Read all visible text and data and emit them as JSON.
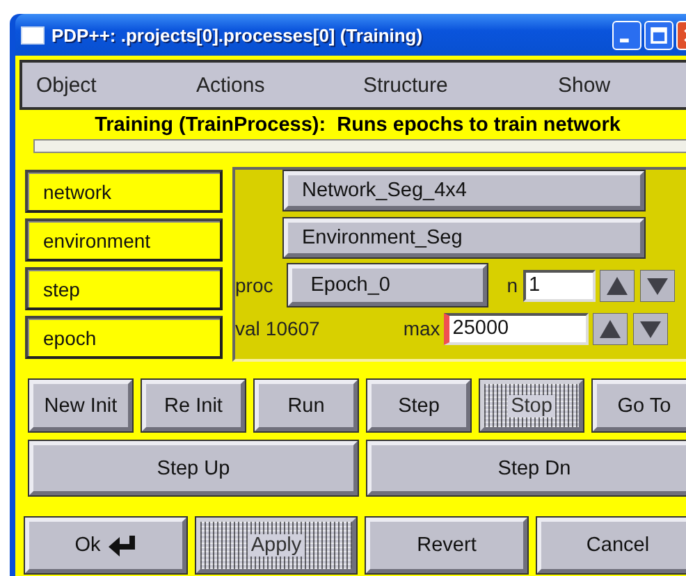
{
  "window": {
    "title": "PDP++:  .projects[0].processes[0] (Training)"
  },
  "menu": [
    "Object",
    "Actions",
    "Structure",
    "Show"
  ],
  "heading": "Training (TrainProcess):  Runs epochs to train network",
  "members": [
    "network",
    "environment",
    "step",
    "epoch"
  ],
  "fields": {
    "network": "Network_Seg_4x4",
    "environment": "Environment_Seg",
    "proc_label": "proc",
    "proc": "Epoch_0",
    "n_label": "n",
    "n": "1",
    "val_label": "val",
    "val": "10607",
    "max_label": "max",
    "max": "25000"
  },
  "actions": [
    {
      "label": "New Init",
      "disabled": false
    },
    {
      "label": "Re Init",
      "disabled": false
    },
    {
      "label": "Run",
      "disabled": false
    },
    {
      "label": "Step",
      "disabled": false
    },
    {
      "label": "Stop",
      "disabled": true
    },
    {
      "label": "Go To",
      "disabled": false
    }
  ],
  "step_buttons": [
    {
      "label": "Step Up",
      "disabled": false
    },
    {
      "label": "Step Dn",
      "disabled": false
    }
  ],
  "dialog_buttons": [
    {
      "label": "Ok",
      "kind": "default",
      "disabled": false
    },
    {
      "label": "Apply",
      "kind": "plain",
      "disabled": true
    },
    {
      "label": "Revert",
      "kind": "plain",
      "disabled": false
    },
    {
      "label": "Cancel",
      "kind": "plain",
      "disabled": false
    }
  ]
}
